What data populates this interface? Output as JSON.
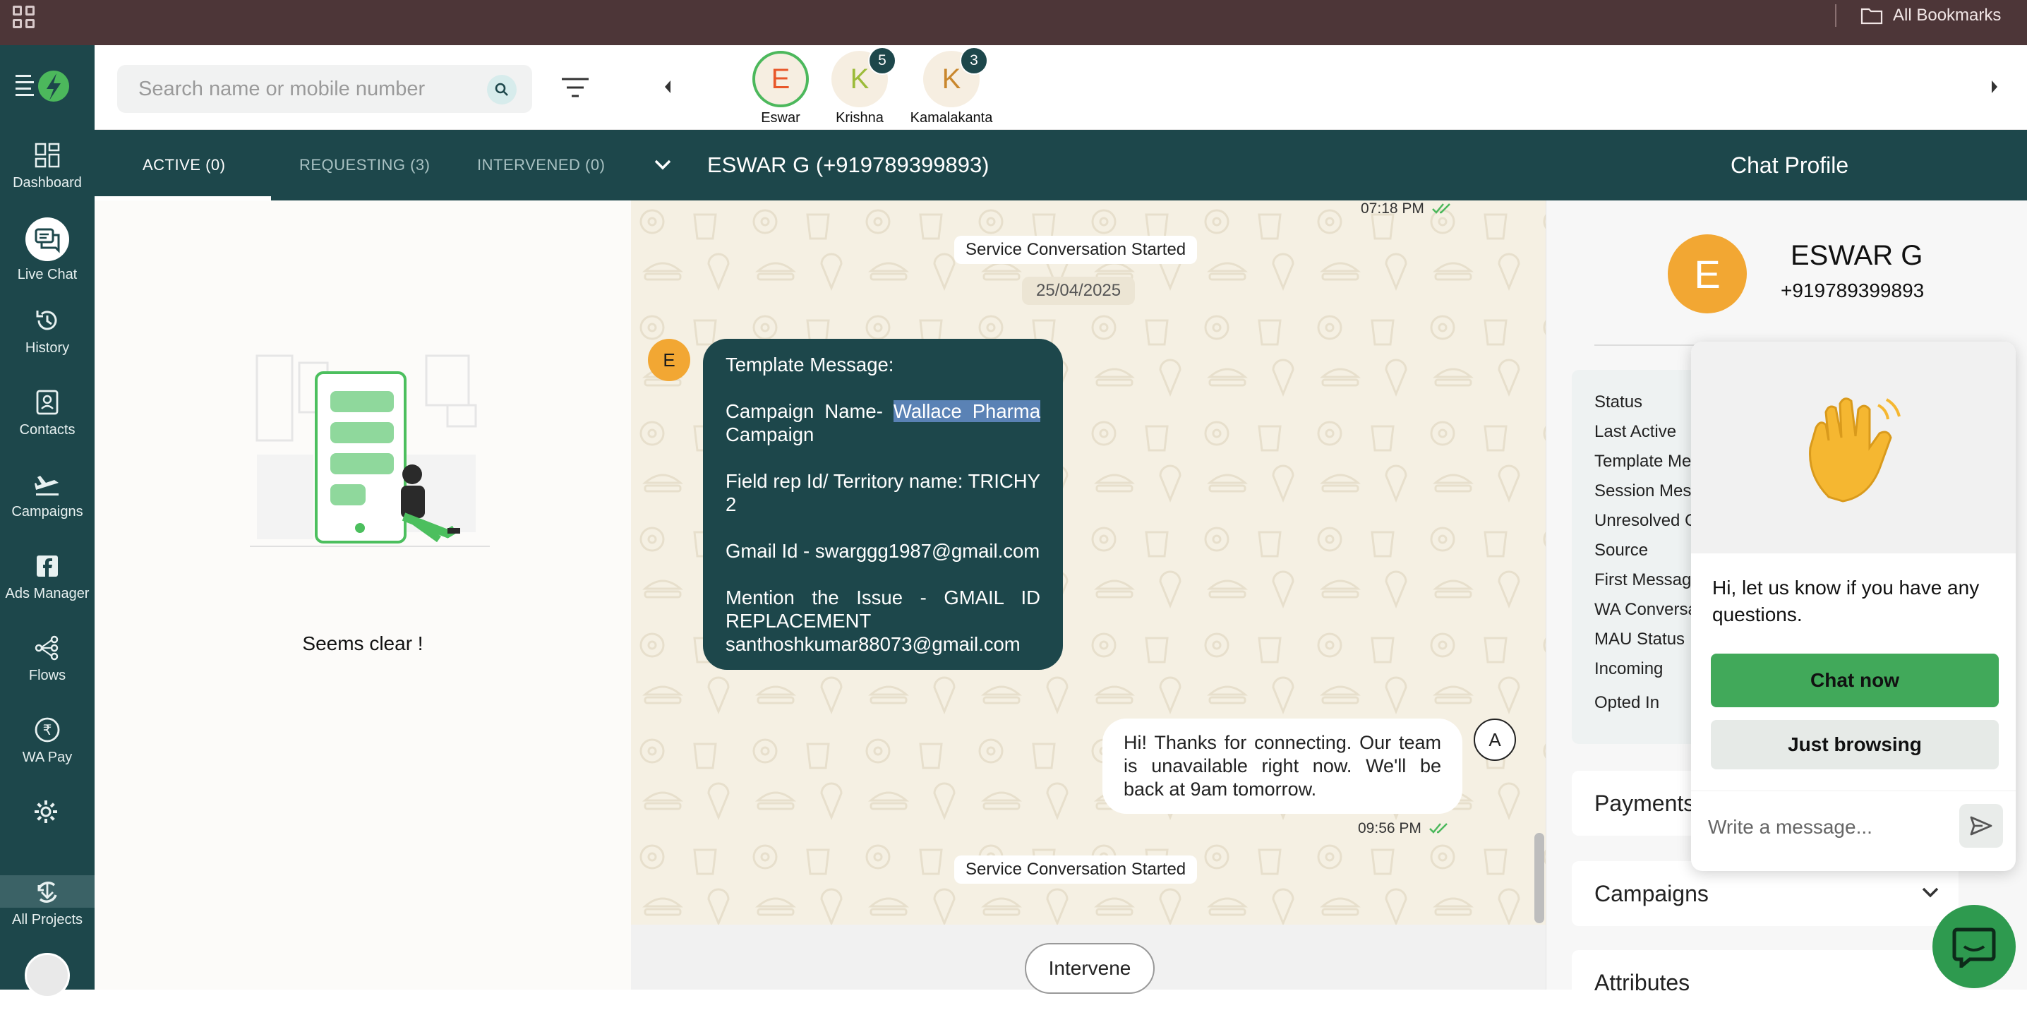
{
  "topbar": {
    "bookmarks_label": "All Bookmarks"
  },
  "sidebar": {
    "items": [
      {
        "label": "Dashboard",
        "icon": "dashboard-icon"
      },
      {
        "label": "Live Chat",
        "icon": "chat-icon"
      },
      {
        "label": "History",
        "icon": "history-icon"
      },
      {
        "label": "Contacts",
        "icon": "contacts-icon"
      },
      {
        "label": "Campaigns",
        "icon": "plane-icon"
      },
      {
        "label": "Ads Manager",
        "icon": "facebook-icon"
      },
      {
        "label": "Flows",
        "icon": "flows-icon"
      },
      {
        "label": "WA Pay",
        "icon": "rupee-icon"
      },
      {
        "label": "All Projects",
        "icon": "projects-icon"
      }
    ]
  },
  "header": {
    "search_placeholder": "Search name or mobile number",
    "chips": [
      {
        "initial": "E",
        "name": "Eswar",
        "badge": "",
        "color": "#e8572a"
      },
      {
        "initial": "K",
        "name": "Krishna",
        "badge": "5",
        "color": "#9cbb3a"
      },
      {
        "initial": "K",
        "name": "Kamalakanta",
        "badge": "3",
        "color": "#c9872d"
      }
    ]
  },
  "tabs": [
    {
      "label": "ACTIVE (0)"
    },
    {
      "label": "REQUESTING (3)"
    },
    {
      "label": "INTERVENED (0)"
    }
  ],
  "conversation": {
    "title": "ESWAR G (+919789399893)",
    "left_empty_text": "Seems clear !",
    "time_top": "07:18 PM",
    "sys_started_1": "Service Conversation Started",
    "date": "25/04/2025",
    "incoming_avatar": "E",
    "template": {
      "line1": "Template Message:",
      "campaign_prefix": "Campaign Name- ",
      "campaign_highlight": "Wallace Pharma",
      "campaign_suffix": "Campaign",
      "field_rep": "Field rep Id/ Territory name: TRICHY 2",
      "gmail": "Gmail Id - swarggg1987@gmail.com",
      "issue": "Mention the Issue - GMAIL ID REPLACEMENT santhoshkumar88073@gmail.com"
    },
    "outgoing_text": "Hi! Thanks for connecting. Our team is unavailable right now. We'll be back at 9am tomorrow.",
    "outgoing_avatar": "A",
    "time_out": "09:56 PM",
    "sys_started_2": "Service Conversation Started",
    "intervene_label": "Intervene"
  },
  "profile": {
    "panel_title": "Chat Profile",
    "initial": "E",
    "name": "ESWAR G",
    "phone": "+919789399893",
    "rows": [
      "Status",
      "Last Active",
      "Template Me",
      "Session Mes",
      "Unresolved Q",
      "Source",
      "First Messag",
      "WA Conversa",
      "MAU Status",
      "Incoming",
      "Opted In"
    ],
    "sections": [
      "Payments",
      "Campaigns",
      "Attributes"
    ]
  },
  "widget": {
    "message": "Hi, let us know if you have any questions.",
    "chat_now": "Chat now",
    "just_browsing": "Just browsing",
    "input_placeholder": "Write a message..."
  },
  "colors": {
    "teal": "#1d474b",
    "accent_orange": "#f2a733",
    "green": "#41a95a",
    "topbar": "#4d3638"
  }
}
